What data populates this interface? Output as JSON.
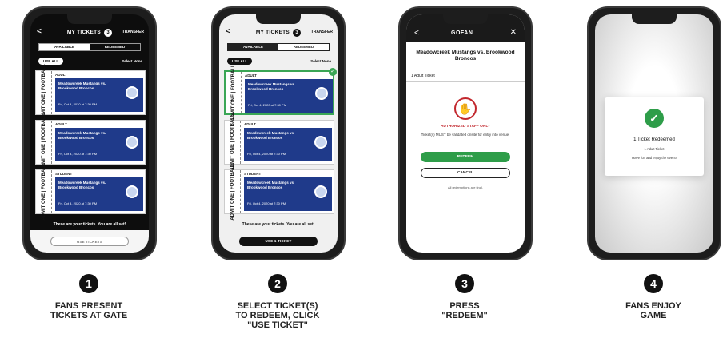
{
  "steps": [
    {
      "number": "1",
      "caption": "FANS PRESENT\nTICKETS AT GATE"
    },
    {
      "number": "2",
      "caption": "SELECT TICKET(S)\nTO REDEEM, CLICK\n\"USE TICKET\""
    },
    {
      "number": "3",
      "caption": "PRESS\n\"REDEEM\""
    },
    {
      "number": "4",
      "caption": "FANS ENJOY\nGAME"
    }
  ],
  "wallet": {
    "back": "<",
    "title": "MY TICKETS",
    "count": "3",
    "transfer": "TRANSFER",
    "tab_available": "AVAILABLE",
    "tab_redeemed": "REDEEMED",
    "use_all": "USE ALL",
    "select_none": "Select None",
    "all_set": "These are your tickets. You are all set!",
    "use_tickets_btn": "USE TICKETS",
    "use_1_ticket_btn": "USE 1 TICKET",
    "stub_text": "ADMIT ONE | FOOTBALL",
    "tickets": [
      {
        "type": "ADULT",
        "event": "Meadowcreek Mustangs vs. Brookwood Broncos",
        "date": "Fri, Oct 4, 2020 at 7:30 PM"
      },
      {
        "type": "ADULT",
        "event": "Meadowcreek Mustangs vs. Brookwood Broncos",
        "date": "Fri, Oct 4, 2020 at 7:30 PM"
      },
      {
        "type": "STUDENT",
        "event": "Meadowcreek Mustangs vs. Brookwood Broncos",
        "date": "Fri, Oct 4, 2020 at 7:30 PM"
      }
    ]
  },
  "redeem_screen": {
    "back": "<",
    "logo": "GOFAN",
    "close": "✕",
    "event": "Meadowcreek Mustangs vs. Brookwood Broncos",
    "qty": "1 Adult Ticket",
    "hand_icon": "✋",
    "auth": "AUTHORIZED STAFF ONLY",
    "note": "Ticket(s) MUST be validated onsite for entry into venue.",
    "redeem_btn": "REDEEM",
    "cancel_btn": "CANCEL",
    "final": "All redemptions are final."
  },
  "success": {
    "check": "✓",
    "title": "1 Ticket Redeemed",
    "sub": "1 Adult Ticket",
    "msg": "Have fun and enjoy the event!"
  }
}
